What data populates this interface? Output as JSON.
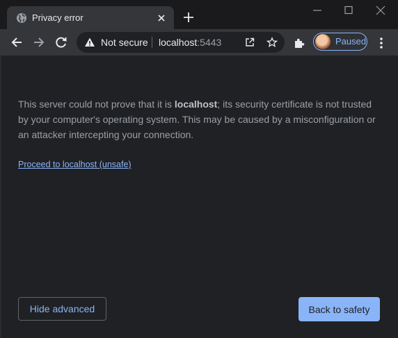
{
  "tab": {
    "title": "Privacy error",
    "favicon": "globe-icon",
    "close": "close-icon"
  },
  "toolbar": {
    "security_label": "Not secure",
    "url_host": "localhost",
    "url_port": ":5443",
    "profile_label": "Paused"
  },
  "page": {
    "details_prefix": "This server could not prove that it is ",
    "details_host": "localhost",
    "details_suffix": "; its security certificate is not trusted by your computer's operating system. This may be caused by a misconfiguration or an attacker intercepting your connection.",
    "proceed_link": "Proceed to localhost (unsafe)",
    "hide_advanced": "Hide advanced",
    "back_to_safety": "Back to safety"
  },
  "colors": {
    "accent": "#8ab4f8",
    "background": "#202124",
    "toolbar": "#35363a"
  }
}
